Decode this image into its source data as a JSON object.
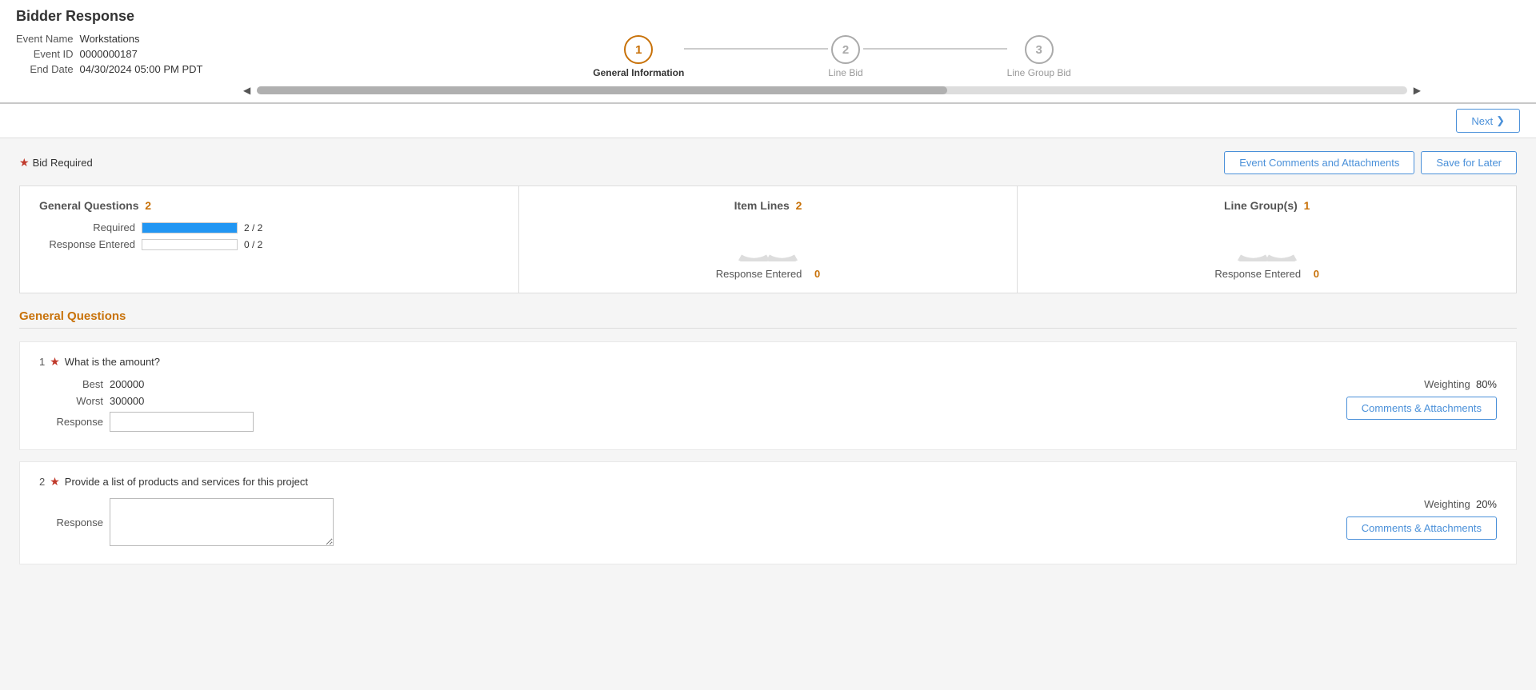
{
  "page": {
    "title": "Bidder Response"
  },
  "event_info": {
    "label_name": "Event Name",
    "label_id": "Event ID",
    "label_end": "End Date",
    "name": "Workstations",
    "id": "0000000187",
    "end_date": "04/30/2024 05:00 PM PDT"
  },
  "steps": [
    {
      "number": "1",
      "label": "General Information",
      "state": "active"
    },
    {
      "number": "2",
      "label": "Line Bid",
      "state": "inactive"
    },
    {
      "number": "3",
      "label": "Line Group Bid",
      "state": "inactive"
    }
  ],
  "toolbar": {
    "next_label": "Next",
    "event_comments_label": "Event Comments and Attachments",
    "save_later_label": "Save for Later"
  },
  "bid_required": {
    "star": "★",
    "label": "Bid Required"
  },
  "summary": {
    "cards": [
      {
        "title": "General Questions",
        "count": "2",
        "rows": [
          {
            "label": "Required",
            "filled": 100,
            "text": "2 / 2"
          },
          {
            "label": "Response Entered",
            "filled": 0,
            "text": "0 / 2"
          }
        ]
      },
      {
        "title": "Item Lines",
        "count": "2",
        "response_label": "Response Entered",
        "response_count": "0"
      },
      {
        "title": "Line Group(s)",
        "count": "1",
        "response_label": "Response Entered",
        "response_count": "0"
      }
    ]
  },
  "general_questions": {
    "section_title": "General Questions",
    "questions": [
      {
        "number": "1",
        "required": true,
        "text": "What is the amount?",
        "best_label": "Best",
        "best_value": "200000",
        "worst_label": "Worst",
        "worst_value": "300000",
        "response_label": "Response",
        "weighting_label": "Weighting",
        "weighting_value": "80%",
        "comments_label": "Comments & Attachments"
      },
      {
        "number": "2",
        "required": true,
        "text": "Provide a list of products and services for this project",
        "response_label": "Response",
        "weighting_label": "Weighting",
        "weighting_value": "20%",
        "comments_label": "Comments & Attachments"
      }
    ]
  }
}
